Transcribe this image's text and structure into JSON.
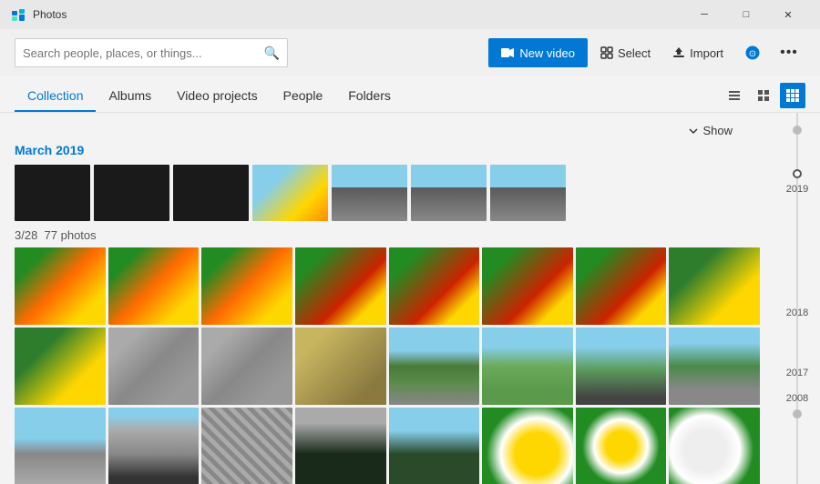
{
  "app": {
    "title": "Photos"
  },
  "titlebar": {
    "minimize_label": "─",
    "maximize_label": "□",
    "close_label": "✕"
  },
  "toolbar": {
    "search_placeholder": "Search people, places, or things...",
    "new_video_label": "New video",
    "select_label": "Select",
    "import_label": "Import",
    "more_label": "•••"
  },
  "nav": {
    "tabs": [
      {
        "id": "collection",
        "label": "Collection",
        "active": true
      },
      {
        "id": "albums",
        "label": "Albums",
        "active": false
      },
      {
        "id": "video-projects",
        "label": "Video projects",
        "active": false
      },
      {
        "id": "people",
        "label": "People",
        "active": false
      },
      {
        "id": "folders",
        "label": "Folders",
        "active": false
      }
    ],
    "view_options": [
      "list",
      "grid-small",
      "grid-large"
    ],
    "show_label": "Show"
  },
  "content": {
    "section_title": "March 2019",
    "date_info": "3/28",
    "photo_count": "77 photos",
    "timeline": {
      "years": [
        "2019",
        "2018",
        "2017",
        "2008"
      ]
    }
  }
}
